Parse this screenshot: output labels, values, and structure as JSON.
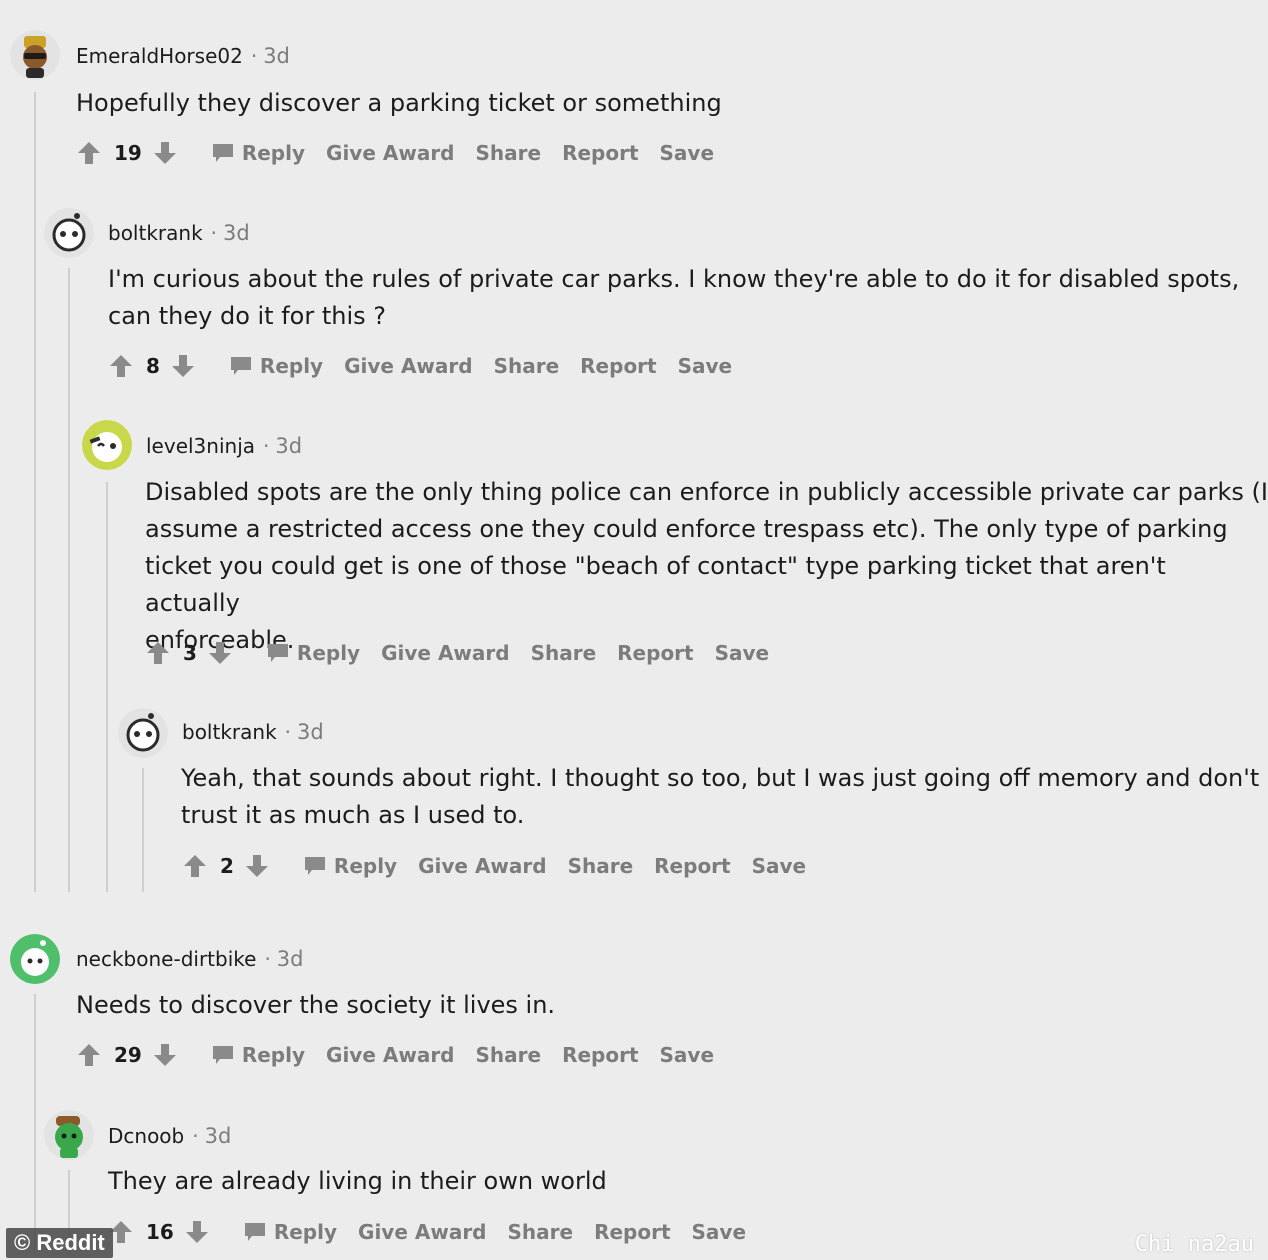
{
  "actions": {
    "reply": "Reply",
    "give_award": "Give Award",
    "share": "Share",
    "report": "Report",
    "save": "Save"
  },
  "separator": "·",
  "comments": [
    {
      "username": "EmeraldHorse02",
      "age": "3d",
      "text": "Hopefully they discover a parking ticket or something",
      "score": "19"
    },
    {
      "username": "boltkrank",
      "age": "3d",
      "text": "I'm curious about the rules of private car parks. I know they're able to do it for disabled spots,\ncan they do it for this ?",
      "score": "8"
    },
    {
      "username": "level3ninja",
      "age": "3d",
      "text": "Disabled spots are the only thing police can enforce in publicly accessible private car parks (I\nassume a restricted access one they could enforce trespass etc). The only type of parking\nticket you could get is one of those \"beach of contact\" type parking ticket that aren't actually\nenforceable.",
      "score": "3"
    },
    {
      "username": "boltkrank",
      "age": "3d",
      "text": "Yeah, that sounds about right. I thought so too, but I was just going off memory and don't\ntrust it as much as I used to.",
      "score": "2"
    },
    {
      "username": "neckbone-dirtbike",
      "age": "3d",
      "text": "Needs to discover the society it lives in.",
      "score": "29"
    },
    {
      "username": "Dcnoob",
      "age": "3d",
      "text": "They are already living in their own world",
      "score": "16"
    }
  ],
  "watermarks": {
    "left": "© Reddit",
    "right": "Chi na2au"
  },
  "colors": {
    "background": "#ececec",
    "muted_text": "#7c7c7c",
    "thread_line": "#cfcfcf"
  }
}
